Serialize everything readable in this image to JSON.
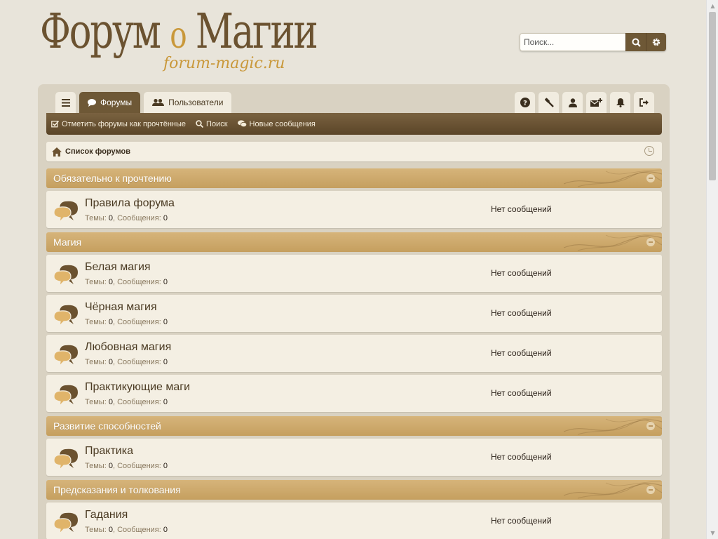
{
  "header": {
    "logo_main_pre": "Форум ",
    "logo_main_o": "о",
    "logo_main_post": " Магии",
    "logo_sub": "forum-magic.ru",
    "search_placeholder": "Поиск..."
  },
  "nav": {
    "tabs": [
      {
        "label": "Форумы",
        "icon": "comment-icon",
        "active": true
      },
      {
        "label": "Пользователи",
        "icon": "users-icon",
        "active": false
      }
    ],
    "tools": [
      "help-icon",
      "gavel-icon",
      "user-icon",
      "mail-plus-icon",
      "bell-icon",
      "sign-out-icon"
    ],
    "sub_links": [
      {
        "label": "Отметить форумы как прочтённые",
        "icon": "check-square-icon"
      },
      {
        "label": "Поиск",
        "icon": "search-icon"
      },
      {
        "label": "Новые сообщения",
        "icon": "comments-icon"
      }
    ]
  },
  "breadcrumb": {
    "label": "Список форумов"
  },
  "labels": {
    "topics": "Темы:",
    "posts": "Сообщения:",
    "no_posts": "Нет сообщений"
  },
  "categories": [
    {
      "title": "Обязательно к прочтению",
      "forums": [
        {
          "title": "Правила форума",
          "topics": "0",
          "posts": "0"
        }
      ]
    },
    {
      "title": "Магия",
      "forums": [
        {
          "title": "Белая магия",
          "topics": "0",
          "posts": "0"
        },
        {
          "title": "Чёрная магия",
          "topics": "0",
          "posts": "0"
        },
        {
          "title": "Любовная магия",
          "topics": "0",
          "posts": "0"
        },
        {
          "title": "Практикующие маги",
          "topics": "0",
          "posts": "0"
        }
      ]
    },
    {
      "title": "Развитие способностей",
      "forums": [
        {
          "title": "Практика",
          "topics": "0",
          "posts": "0"
        }
      ]
    },
    {
      "title": "Предсказания и толкования",
      "forums": [
        {
          "title": "Гадания",
          "topics": "0",
          "posts": "0"
        }
      ]
    }
  ],
  "colors": {
    "brown": "#6e5836",
    "tan": "#c59f5f",
    "panel": "#f4efe3"
  }
}
